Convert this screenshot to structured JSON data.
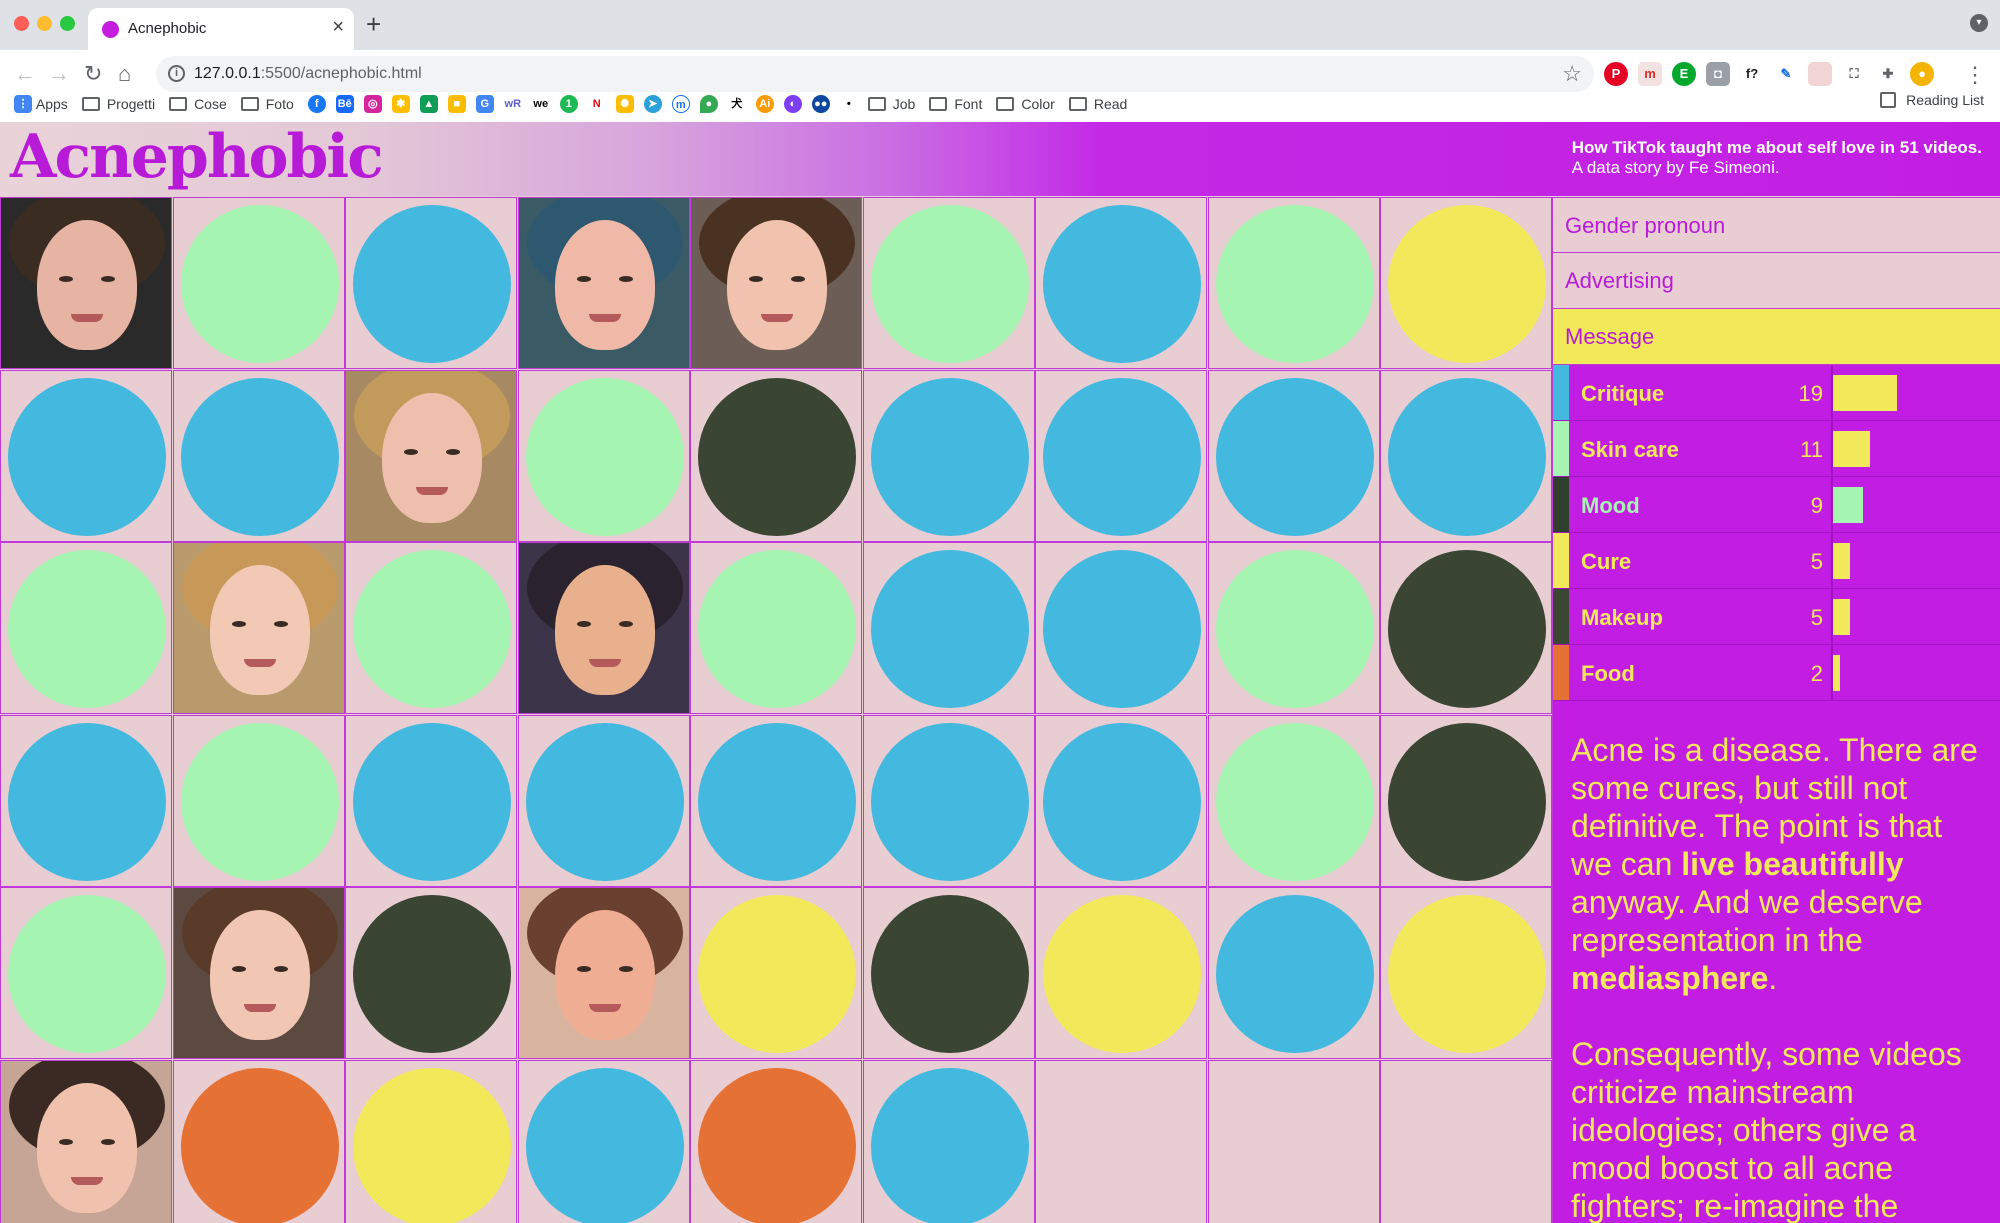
{
  "browser": {
    "tab_title": "Acnephobic",
    "tab_close": "×",
    "new_tab": "+",
    "url_host": "127.0.0.1",
    "url_rest": ":5500/acnephobic.html",
    "bookmarks": [
      "Apps",
      "Progetti",
      "Cose",
      "Foto",
      "Job",
      "Font",
      "Color",
      "Read"
    ],
    "reading_list": "Reading List"
  },
  "page": {
    "logo": "Acnephobic",
    "subtitle_line1": "How TikTok taught me about self love in 51 videos.",
    "subtitle_line2": "A data story by Fe Simeoni."
  },
  "filters": {
    "gender": "Gender pronoun",
    "ads": "Advertising",
    "message": "Message"
  },
  "legend": [
    {
      "name": "Critique",
      "count": "19",
      "value": 19,
      "color": "#44b9df"
    },
    {
      "name": "Skin care",
      "count": "11",
      "value": 11,
      "color": "#a7f5b3"
    },
    {
      "name": "Mood",
      "count": "9",
      "value": 9,
      "color": "#2f3f2e"
    },
    {
      "name": "Cure",
      "count": "5",
      "value": 5,
      "color": "#f2e95a"
    },
    {
      "name": "Makeup",
      "count": "5",
      "value": 5,
      "color": "#3a4733"
    },
    {
      "name": "Food",
      "count": "2",
      "value": 2,
      "color": "#e57234"
    }
  ],
  "story": {
    "p1_a": "Acne is a disease. There are some cures, but still not definitive. The point is that we can ",
    "p1_b": "live beautifully",
    "p1_c": " anyway. And we deserve representation in the ",
    "p1_d": "mediasphere",
    "p1_e": ".",
    "p2": "Consequently, some videos criticize mainstream ideologies; others give a mood boost to all acne fighters; re-imagine the"
  },
  "colors": {
    "blue": "#44b9df",
    "mint": "#a7f5b3",
    "dark": "#3a4533",
    "yellow": "#f2e95a",
    "orange": "#e57234",
    "magenta": "#c21ee3"
  },
  "grid": [
    [
      "face1",
      "mint",
      "blue",
      "face2",
      "face3",
      "mint",
      "blue",
      "mint",
      "yellow"
    ],
    [
      "blue",
      "blue",
      "face4",
      "mint",
      "dark",
      "blue",
      "blue",
      "blue",
      "blue"
    ],
    [
      "mint",
      "face5",
      "mint",
      "face6",
      "mint",
      "blue",
      "blue",
      "mint",
      "dark"
    ],
    [
      "blue",
      "mint",
      "blue",
      "blue",
      "blue",
      "blue",
      "blue",
      "mint",
      "dark"
    ],
    [
      "mint",
      "face7",
      "dark",
      "face8",
      "yellow",
      "dark",
      "yellow",
      "blue",
      "yellow"
    ],
    [
      "face9",
      "orange",
      "yellow",
      "blue",
      "orange",
      "blue",
      "empty",
      "empty",
      "empty"
    ]
  ]
}
